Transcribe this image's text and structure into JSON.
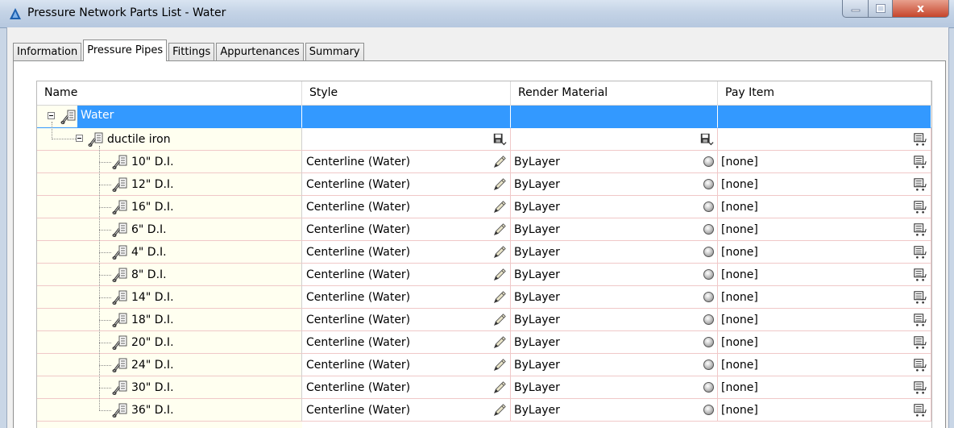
{
  "window": {
    "title": "Pressure Network Parts List - Water",
    "close_label": "x"
  },
  "tabs": [
    "Information",
    "Pressure Pipes",
    "Fittings",
    "Appurtenances",
    "Summary"
  ],
  "active_tab": "Pressure Pipes",
  "columns": [
    "Name",
    "Style",
    "Render Material",
    "Pay Item"
  ],
  "root": {
    "name": "Water"
  },
  "group": {
    "name": "ductile iron"
  },
  "pipes": [
    {
      "name": "10\" D.I.",
      "style": "Centerline (Water)",
      "material": "ByLayer",
      "pay_item": "[none]"
    },
    {
      "name": "12\" D.I.",
      "style": "Centerline (Water)",
      "material": "ByLayer",
      "pay_item": "[none]"
    },
    {
      "name": "16\" D.I.",
      "style": "Centerline (Water)",
      "material": "ByLayer",
      "pay_item": "[none]"
    },
    {
      "name": "6\" D.I.",
      "style": "Centerline (Water)",
      "material": "ByLayer",
      "pay_item": "[none]"
    },
    {
      "name": "4\" D.I.",
      "style": "Centerline (Water)",
      "material": "ByLayer",
      "pay_item": "[none]"
    },
    {
      "name": "8\" D.I.",
      "style": "Centerline (Water)",
      "material": "ByLayer",
      "pay_item": "[none]"
    },
    {
      "name": "14\" D.I.",
      "style": "Centerline (Water)",
      "material": "ByLayer",
      "pay_item": "[none]"
    },
    {
      "name": "18\" D.I.",
      "style": "Centerline (Water)",
      "material": "ByLayer",
      "pay_item": "[none]"
    },
    {
      "name": "20\" D.I.",
      "style": "Centerline (Water)",
      "material": "ByLayer",
      "pay_item": "[none]"
    },
    {
      "name": "24\" D.I.",
      "style": "Centerline (Water)",
      "material": "ByLayer",
      "pay_item": "[none]"
    },
    {
      "name": "30\" D.I.",
      "style": "Centerline (Water)",
      "material": "ByLayer",
      "pay_item": "[none]"
    },
    {
      "name": "36\" D.I.",
      "style": "Centerline (Water)",
      "material": "ByLayer",
      "pay_item": "[none]"
    }
  ],
  "icons": {
    "app": "autocad-a-icon",
    "tree": "pipe-part-icon",
    "style_edit": "pencil-edit-icon",
    "material": "render-material-sphere-icon",
    "pay_item": "pay-item-cart-icon",
    "save": "save-floppy-icon"
  },
  "colors": {
    "selection": "#3399ff",
    "tree_background": "#fffff0",
    "grid_line": "#f0c8c8"
  }
}
